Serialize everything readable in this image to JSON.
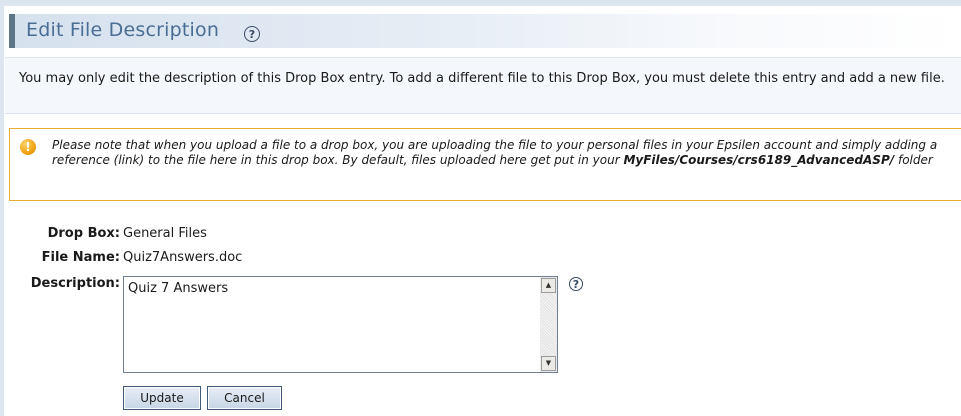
{
  "page": {
    "title": "Edit File Description",
    "help_icon": "question-circle-icon"
  },
  "intro": {
    "text": "You may only edit the description of this Drop Box entry. To add a different file to this Drop Box, you must delete this entry and add a new file."
  },
  "notice": {
    "icon": "warning-icon",
    "text_before": "Please note that when you upload a file to a drop box, you are uploading the file to your personal files in your Epsilen account and simply adding a reference (link) to the file here in this drop box. By default, files uploaded here get put in your",
    "path": "MyFiles/Courses/crs6189_AdvancedASP/",
    "text_after": "folder"
  },
  "form": {
    "drop_box_label": "Drop Box:",
    "drop_box_value": "General Files",
    "file_name_label": "File Name:",
    "file_name_value": "Quiz7Answers.doc",
    "description_label": "Description:",
    "description_value": "Quiz 7 Answers"
  },
  "buttons": {
    "update": "Update",
    "cancel": "Cancel"
  },
  "colors": {
    "title": "#4a6d94",
    "notice_border": "#e8ad35",
    "button_border": "#3f5a78"
  }
}
